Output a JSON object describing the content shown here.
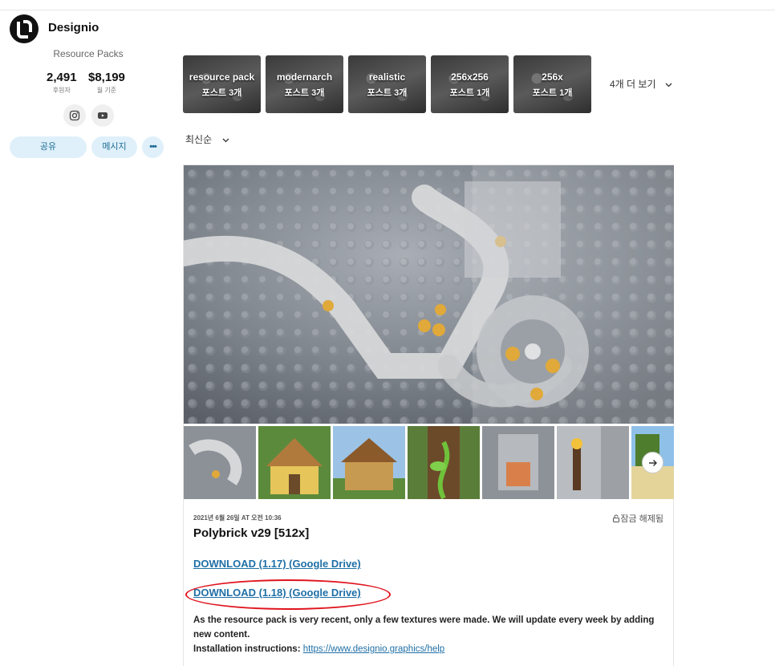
{
  "header": {
    "brand": "Designio"
  },
  "profile": {
    "subtitle": "Resource Packs",
    "stats": [
      {
        "value": "2,491",
        "label": "후원자"
      },
      {
        "value": "$8,199",
        "label": "월 기준"
      }
    ],
    "social_icons": [
      "instagram-icon",
      "youtube-icon"
    ],
    "share_label": "공유",
    "message_label": "메시지",
    "more_label": "•••"
  },
  "tags": [
    {
      "name": "resource pack",
      "count": "포스트 3개"
    },
    {
      "name": "modernarch",
      "count": "포스트 3개"
    },
    {
      "name": "realistic",
      "count": "포스트 3개"
    },
    {
      "name": "256x256",
      "count": "포스트 1개"
    },
    {
      "name": "256x",
      "count": "포스트 1개"
    }
  ],
  "more_tags_label": "4개 더 보기",
  "sort_label": "최신순",
  "post": {
    "date": "2021년 6월 26일 AT 오전 10:36",
    "unlocked": "잠금 해제됨",
    "title": "Polybrick v29 [512x]",
    "download_117": "DOWNLOAD (1.17) (Google Drive)",
    "download_118": "DOWNLOAD (1.18) (Google Drive)",
    "description": "As the resource pack is very recent, only a few textures were made. We will update every week by adding new content.",
    "install_label": "Installation instructions:",
    "install_link": "https://www.designio.graphics/help"
  },
  "colors": {
    "accent": "#1f6fa6",
    "pill_bg": "#dff0fa",
    "highlight_circle": "#e0141e"
  }
}
